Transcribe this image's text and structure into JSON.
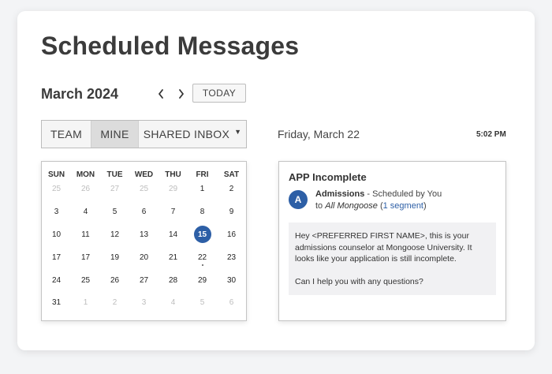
{
  "page": {
    "title": "Scheduled Messages"
  },
  "calendar_nav": {
    "month_label": "March 2024",
    "prev_icon": "chevron-left-icon",
    "next_icon": "chevron-right-icon",
    "today_label": "TODAY"
  },
  "filters": {
    "team": "TEAM",
    "mine": "MINE",
    "shared_inbox": "SHARED INBOX",
    "active": "MINE",
    "dropdown_icon": "caret-down-icon"
  },
  "selected_day": {
    "label": "Friday, March 22",
    "time": "5:02 PM"
  },
  "calendar": {
    "weekdays": [
      "SUN",
      "MON",
      "TUE",
      "WED",
      "THU",
      "FRI",
      "SAT"
    ],
    "weeks": [
      [
        {
          "d": "25",
          "m": true
        },
        {
          "d": "26",
          "m": true
        },
        {
          "d": "27",
          "m": true
        },
        {
          "d": "25",
          "m": true
        },
        {
          "d": "29",
          "m": true
        },
        {
          "d": "1"
        },
        {
          "d": "2"
        }
      ],
      [
        {
          "d": "3"
        },
        {
          "d": "4"
        },
        {
          "d": "5"
        },
        {
          "d": "6"
        },
        {
          "d": "7"
        },
        {
          "d": "8"
        },
        {
          "d": "9"
        }
      ],
      [
        {
          "d": "10"
        },
        {
          "d": "11"
        },
        {
          "d": "12"
        },
        {
          "d": "13"
        },
        {
          "d": "14"
        },
        {
          "d": "15",
          "sel": true
        },
        {
          "d": "16"
        }
      ],
      [
        {
          "d": "17"
        },
        {
          "d": "17"
        },
        {
          "d": "19"
        },
        {
          "d": "20"
        },
        {
          "d": "21"
        },
        {
          "d": "22",
          "dot": true
        },
        {
          "d": "23"
        }
      ],
      [
        {
          "d": "24"
        },
        {
          "d": "25"
        },
        {
          "d": "26"
        },
        {
          "d": "27"
        },
        {
          "d": "28"
        },
        {
          "d": "29"
        },
        {
          "d": "30"
        }
      ],
      [
        {
          "d": "31"
        },
        {
          "d": "1",
          "m": true
        },
        {
          "d": "2",
          "m": true
        },
        {
          "d": "3",
          "m": true
        },
        {
          "d": "4",
          "m": true
        },
        {
          "d": "5",
          "m": true
        },
        {
          "d": "6",
          "m": true
        }
      ]
    ],
    "selected_color": "#2d5fa6"
  },
  "message": {
    "title": "APP Incomplete",
    "avatar_letter": "A",
    "sender": "Admissions",
    "scheduled_by": " - Scheduled by You",
    "to_prefix": "to ",
    "audience": "All Mongoose",
    "segment_open": " (",
    "segment_link": "1 segment",
    "segment_close": ")",
    "body_p1": "Hey <PREFERRED FIRST NAME>, this is your admissions counselor at Mongoose University. It looks like your application is still incomplete.",
    "body_p2": "Can I help you with any questions?"
  }
}
